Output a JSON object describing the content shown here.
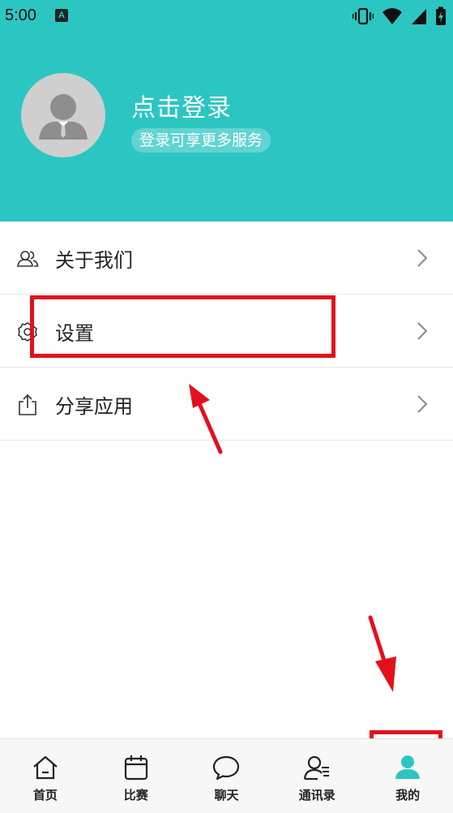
{
  "status_bar": {
    "time": "5:00",
    "app_icon_letter": "A"
  },
  "header": {
    "login_title": "点击登录",
    "login_subtitle": "登录可享更多服务"
  },
  "menu": {
    "items": [
      {
        "label": "关于我们",
        "icon": "people-icon"
      },
      {
        "label": "设置",
        "icon": "gear-icon"
      },
      {
        "label": "分享应用",
        "icon": "share-icon"
      }
    ]
  },
  "tabs": [
    {
      "label": "首页",
      "icon": "home-icon"
    },
    {
      "label": "比赛",
      "icon": "calendar-icon"
    },
    {
      "label": "聊天",
      "icon": "chat-bubble-icon"
    },
    {
      "label": "通讯录",
      "icon": "contacts-icon"
    },
    {
      "label": "我的",
      "icon": "user-icon",
      "active": true
    }
  ],
  "colors": {
    "brand": "#2cc6c2",
    "annotation": "#e3101b",
    "active_tab_icon": "#2cc6c2"
  }
}
